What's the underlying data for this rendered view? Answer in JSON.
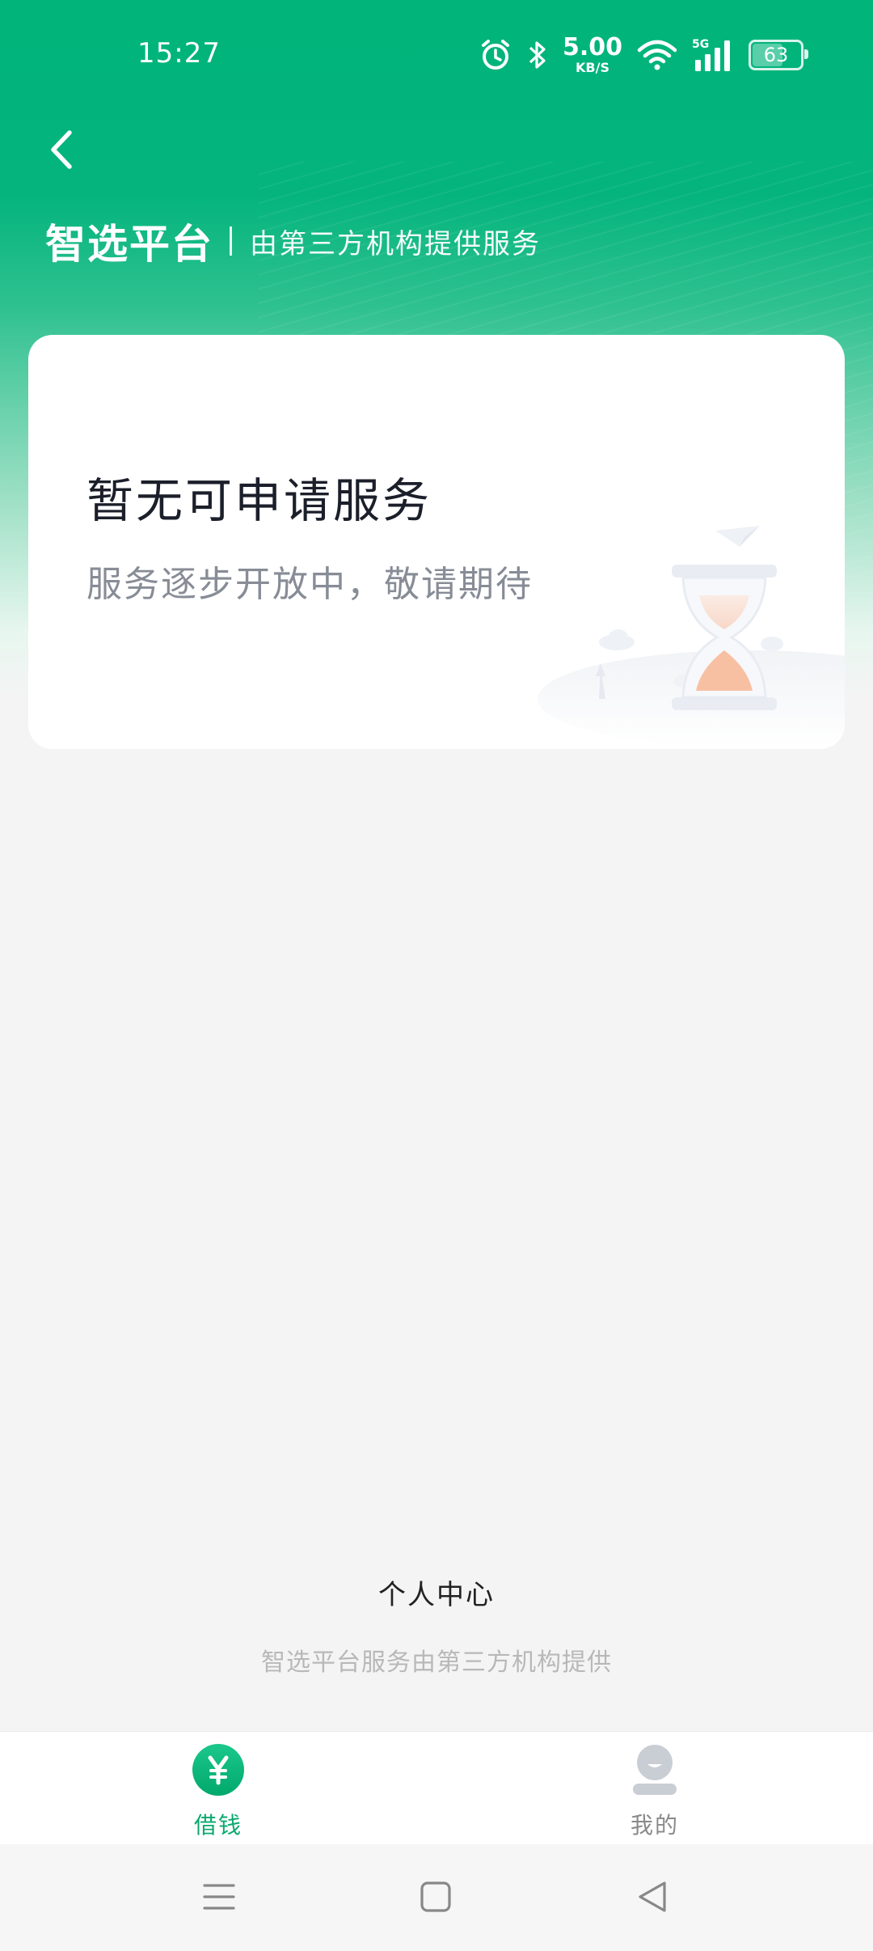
{
  "status_bar": {
    "time": "15:27",
    "net_speed_value": "5.00",
    "net_speed_unit": "KB/S",
    "signal_type": "5G",
    "battery_level": "63",
    "icons": [
      "alarm-icon",
      "bluetooth-icon",
      "wifi-icon",
      "cellular-signal-icon",
      "battery-icon"
    ]
  },
  "header": {
    "brand": "智选平台",
    "subtitle": "由第三方机构提供服务",
    "back_icon": "chevron-left-icon"
  },
  "card": {
    "title": "暂无可申请服务",
    "description": "服务逐步开放中，敬请期待",
    "illustration": "hourglass-icon"
  },
  "footer": {
    "personal_center": "个人中心",
    "note": "智选平台服务由第三方机构提供"
  },
  "tab_bar": {
    "tabs": [
      {
        "label": "借钱",
        "icon": "yen-icon",
        "active": true
      },
      {
        "label": "我的",
        "icon": "user-icon",
        "active": false
      }
    ]
  },
  "nav_bar": {
    "buttons": [
      "menu-icon",
      "home-icon",
      "back-icon"
    ]
  },
  "colors": {
    "brand_green": "#00b47a",
    "active_tab": "#0aa86f",
    "inactive_tab": "#8a8a8a",
    "background": "#f4f4f4"
  }
}
